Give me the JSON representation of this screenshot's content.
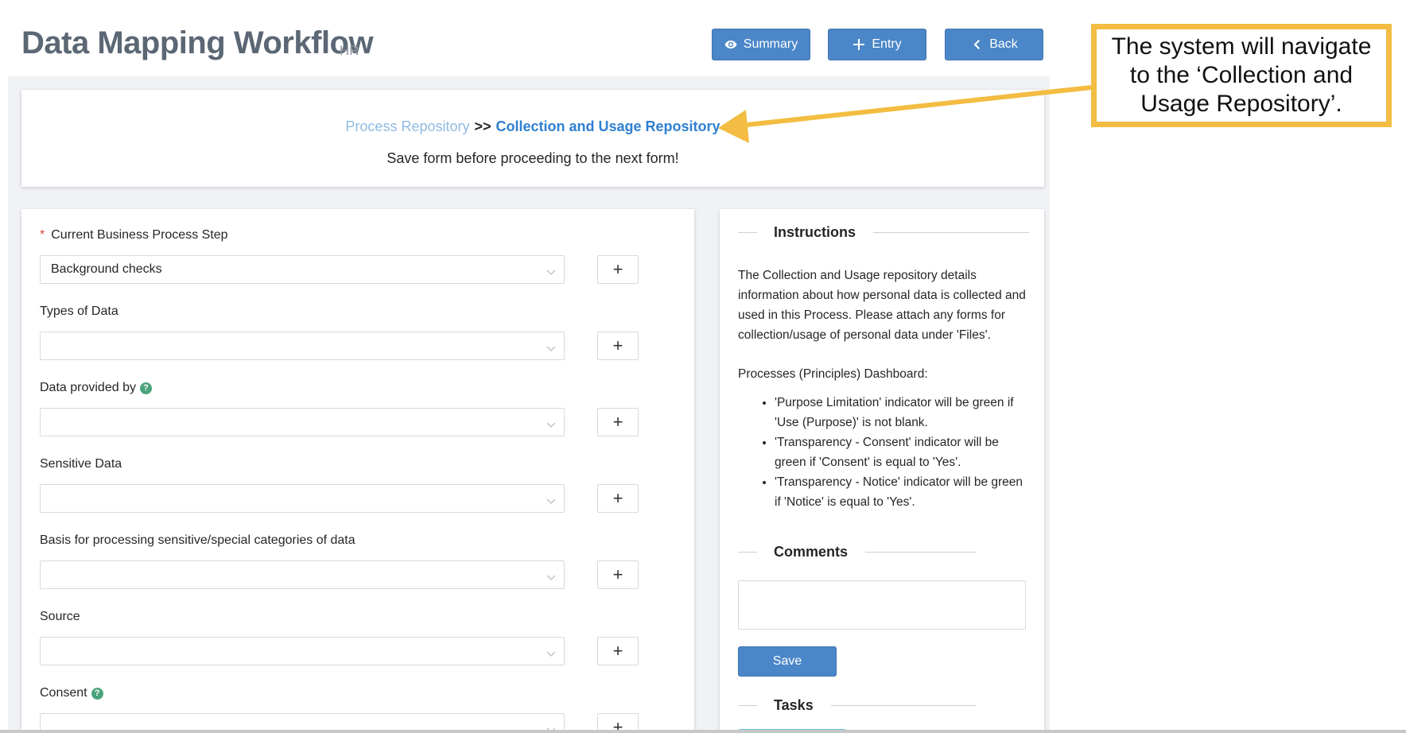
{
  "header": {
    "title": "Data Mapping Workflow",
    "subtitle": "HR",
    "buttons": {
      "summary": "Summary",
      "entry": "Entry",
      "back": "Back"
    }
  },
  "breadcrumb": {
    "parent": "Process Repository",
    "separator": ">>",
    "current": "Collection and Usage Repository",
    "note": "Save form before proceeding to the next form!"
  },
  "form": {
    "fields": [
      {
        "label": "Current Business Process Step",
        "required": true,
        "help": false,
        "value": "Background checks"
      },
      {
        "label": "Types of Data",
        "required": false,
        "help": false,
        "value": ""
      },
      {
        "label": "Data provided by",
        "required": false,
        "help": true,
        "value": ""
      },
      {
        "label": "Sensitive Data",
        "required": false,
        "help": false,
        "value": ""
      },
      {
        "label": "Basis for processing sensitive/special categories of data",
        "required": false,
        "help": false,
        "value": ""
      },
      {
        "label": "Source",
        "required": false,
        "help": false,
        "value": ""
      },
      {
        "label": "Consent",
        "required": false,
        "help": true,
        "value": ""
      }
    ],
    "required_mark": "*",
    "help_glyph": "?",
    "add_glyph": "+"
  },
  "side": {
    "instructions_title": "Instructions",
    "instructions_text": "The Collection and Usage repository details information about how personal data is collected and used in this Process. Please attach any forms for collection/usage of personal data under 'Files'.",
    "dashboard_text": "Processes (Principles) Dashboard:",
    "bullets": [
      "'Purpose Limitation' indicator will be green if 'Use (Purpose)' is not blank.",
      "'Transparency - Consent' indicator will be green if 'Consent' is equal to 'Yes'.",
      "'Transparency - Notice' indicator will be green if 'Notice' is equal to 'Yes'."
    ],
    "comments_title": "Comments",
    "save_label": "Save",
    "tasks_title": "Tasks"
  },
  "callout": {
    "text": "The system will navigate to the ‘Collection and Usage Repository’."
  },
  "colors": {
    "primary": "#4a86c8",
    "title": "#5b6774",
    "link": "#2f7fd1",
    "link_light": "#8fbbe3",
    "callout_border": "#f2bd42",
    "help": "#4ba37a"
  }
}
